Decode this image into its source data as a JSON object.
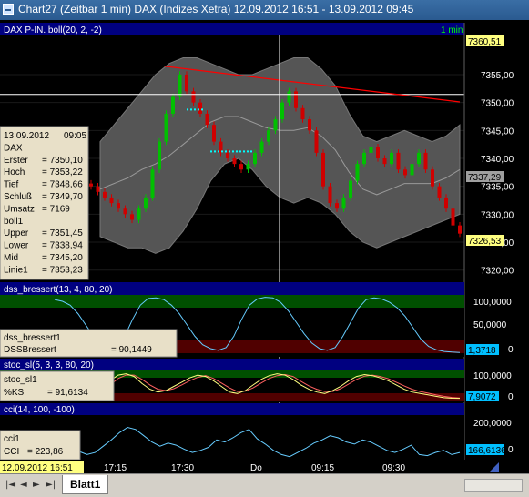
{
  "window": {
    "title": "Chart27 (Zeitbar 1 min)  DAX (Indizes Xetra) 12.09.2012 16:51 - 13.09.2012 09:45"
  },
  "panels": {
    "price": {
      "header": "DAX P-IN. boll(20, 2, -2)",
      "interval": "1 min",
      "y_ticks": [
        "7355,00",
        "7350,00",
        "7345,00",
        "7340,00",
        "7335,00",
        "7330,00",
        "7325,00",
        "7320,00"
      ],
      "last_top": "7360,51",
      "last_mid": "7337,29",
      "last_bottom": "7326,53",
      "info": [
        {
          "label": "13.09.2012",
          "value": "09:05"
        },
        {
          "label": "DAX",
          "value": ""
        },
        {
          "label": "Erster",
          "value": "= 7350,10"
        },
        {
          "label": "Hoch",
          "value": "= 7353,22"
        },
        {
          "label": "Tief",
          "value": "= 7348,66"
        },
        {
          "label": "Schluß",
          "value": "= 7349,70"
        },
        {
          "label": "Umsatz",
          "value": "=      7169"
        },
        {
          "label": "boll1",
          "value": ""
        },
        {
          "label": "Upper",
          "value": "= 7351,45"
        },
        {
          "label": "Lower",
          "value": "= 7338,94"
        },
        {
          "label": "Mid",
          "value": "= 7345,20"
        },
        {
          "label": "Linie1",
          "value": "= 7353,23"
        }
      ]
    },
    "dss": {
      "header": "dss_bressert(13, 4, 80, 20)",
      "y_ticks": [
        "100,0000",
        "50,0000",
        "0"
      ],
      "last": "1,3718",
      "info": [
        {
          "label": "dss_bressert1",
          "value": ""
        },
        {
          "label": "DSSBressert",
          "value": "= 90,1449"
        }
      ]
    },
    "stoc": {
      "header": "stoc_sl(5, 3, 3, 80, 20)",
      "y_ticks": [
        "100,0000",
        "0"
      ],
      "last": "7,9072",
      "info": [
        {
          "label": "stoc_sl1",
          "value": ""
        },
        {
          "label": "%KS",
          "value": "= 91,6134"
        }
      ]
    },
    "cci": {
      "header": "cci(14, 100, -100)",
      "y_ticks": [
        "200,0000",
        "0"
      ],
      "last": "166,6136",
      "info": [
        {
          "label": "cci1",
          "value": ""
        },
        {
          "label": "CCI",
          "value": "= 223,86"
        }
      ]
    }
  },
  "time_axis": {
    "current": "12.09.2012 16:51",
    "labels": [
      "17:15",
      "17:30",
      "Do",
      "09:15",
      "09:30"
    ]
  },
  "sheet_tab": "Blatt1",
  "colors": {
    "background": "#000000",
    "header_bar": "#000080",
    "band": "#555555",
    "up_candle": "#00c000",
    "down_candle": "#d00000",
    "trendline": "#ff0000",
    "oscillator": "#66ccff",
    "zone_high": "#005000",
    "zone_low": "#500000",
    "info_box": "#e8e0c8",
    "last_value_box": "#ffff80"
  },
  "chart_data": [
    {
      "type": "candlestick",
      "title": "DAX P-IN. boll(20, 2, -2)",
      "ylim": [
        7318,
        7362
      ],
      "x_range": [
        "12.09.2012 16:51",
        "13.09.2012 09:45"
      ],
      "close": [
        7335,
        7334,
        7333,
        7332,
        7331,
        7330,
        7329,
        7331,
        7333,
        7338,
        7343,
        7348,
        7351,
        7355,
        7352,
        7350,
        7348,
        7346,
        7343,
        7341,
        7340,
        7339,
        7338,
        7339,
        7341,
        7343,
        7345,
        7347,
        7350,
        7352,
        7349,
        7347,
        7345,
        7341,
        7335,
        7332,
        7331,
        7333,
        7336,
        7339,
        7341,
        7342,
        7340,
        7339,
        7341,
        7338,
        7337,
        7339,
        7341,
        7338,
        7335,
        7333,
        7331,
        7328,
        7326.53
      ],
      "upper_band": [
        7343,
        7346,
        7349,
        7352,
        7355,
        7357,
        7358,
        7358,
        7357,
        7356,
        7355,
        7355,
        7356,
        7357,
        7358,
        7358,
        7356,
        7353,
        7348,
        7344,
        7343,
        7344,
        7345,
        7344,
        7343,
        7344,
        7346
      ],
      "lower_band": [
        7326,
        7325,
        7324,
        7324,
        7323,
        7324,
        7327,
        7331,
        7336,
        7339,
        7340,
        7338,
        7335,
        7333,
        7332,
        7333,
        7332,
        7330,
        7327,
        7325,
        7324,
        7325,
        7326,
        7327,
        7328,
        7329,
        7330
      ],
      "trendline": [
        [
          0.52,
          7356.5
        ],
        [
          1.0,
          7350.1
        ]
      ],
      "horizontal_line": 7351.45,
      "last_value": 7326.53
    },
    {
      "type": "line",
      "title": "dss_bressert(13, 4, 80, 20)",
      "ylim": [
        0,
        100
      ],
      "zones": [
        80,
        20
      ],
      "series": [
        {
          "name": "DSSBressert",
          "values": [
            95,
            92,
            85,
            70,
            50,
            30,
            15,
            8,
            10,
            30,
            60,
            85,
            97,
            98,
            95,
            85,
            70,
            50,
            30,
            15,
            8,
            5,
            10,
            30,
            60,
            85,
            96,
            99,
            98,
            90,
            75,
            55,
            35,
            18,
            8,
            5,
            10,
            30,
            55,
            80,
            95,
            98,
            96,
            90,
            80,
            65,
            45,
            25,
            12,
            6,
            3,
            2,
            1.37
          ]
        }
      ],
      "last_value": 1.3718
    },
    {
      "type": "line",
      "title": "stoc_sl(5, 3, 3, 80, 20)",
      "ylim": [
        0,
        100
      ],
      "zones": [
        80,
        20
      ],
      "series": [
        {
          "name": "%KS",
          "values": [
            60,
            75,
            70,
            50,
            30,
            20,
            40,
            70,
            90,
            95,
            85,
            60,
            40,
            30,
            35,
            50,
            65,
            80,
            90,
            85,
            70,
            50,
            30,
            25,
            35,
            55,
            75,
            88,
            95,
            90,
            75,
            55,
            40,
            30,
            25,
            35,
            50,
            70,
            85,
            92,
            88,
            80,
            70,
            55,
            40,
            30,
            25,
            20,
            15,
            10,
            8,
            7.9
          ]
        },
        {
          "name": "",
          "values": [
            55,
            65,
            72,
            62,
            45,
            30,
            32,
            55,
            78,
            90,
            90,
            75,
            55,
            40,
            35,
            42,
            55,
            70,
            82,
            88,
            78,
            62,
            45,
            32,
            33,
            45,
            62,
            78,
            88,
            92,
            85,
            68,
            52,
            40,
            32,
            32,
            42,
            58,
            75,
            86,
            90,
            85,
            77,
            65,
            52,
            40,
            32,
            26,
            20,
            15,
            11,
            9
          ]
        }
      ],
      "last_value": 7.9072
    },
    {
      "type": "line",
      "title": "cci(14, 100, -100)",
      "ylim": [
        -100,
        300
      ],
      "series": [
        {
          "name": "CCI",
          "values": [
            30,
            60,
            20,
            -30,
            -60,
            -40,
            20,
            80,
            150,
            200,
            180,
            120,
            60,
            20,
            50,
            30,
            -10,
            -40,
            -20,
            10,
            80,
            60,
            100,
            150,
            180,
            90,
            40,
            -20,
            -60,
            -80,
            -40,
            0,
            50,
            80,
            120,
            100,
            60,
            40,
            80,
            60,
            20,
            -20,
            -40,
            -10,
            30,
            -60,
            -70,
            -40,
            -20,
            -60,
            -40
          ]
        }
      ],
      "last_value": 166.6136
    }
  ]
}
